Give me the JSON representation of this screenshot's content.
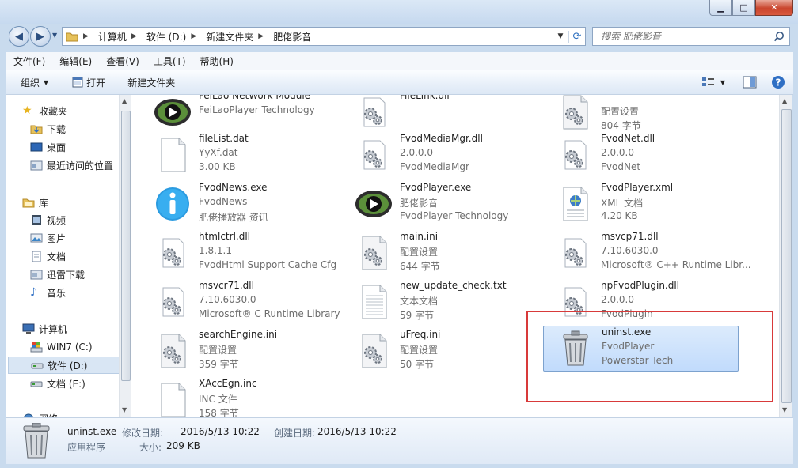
{
  "window": {
    "minimize": "▁",
    "maximize": "□",
    "close": "✕"
  },
  "address": {
    "crumbs": [
      "计算机",
      "软件 (D:)",
      "新建文件夹",
      "肥佬影音"
    ],
    "refresh_icon": "refresh-icon"
  },
  "search": {
    "placeholder": "搜索 肥佬影音"
  },
  "menu": [
    "文件(F)",
    "编辑(E)",
    "查看(V)",
    "工具(T)",
    "帮助(H)"
  ],
  "toolbar": {
    "organize": "组织",
    "open": "打开",
    "new_folder": "新建文件夹"
  },
  "nav": {
    "favorites": "收藏夹",
    "downloads": "下载",
    "desktop": "桌面",
    "recent": "最近访问的位置",
    "libraries": "库",
    "videos": "视频",
    "pictures": "图片",
    "documents": "文档",
    "xunlei": "迅雷下载",
    "music": "音乐",
    "computer": "计算机",
    "drive_c": "WIN7 (C:)",
    "drive_d": "软件 (D:)",
    "drive_e": "文档 (E:)",
    "network": "网络"
  },
  "files": [
    {
      "name": "FeiLao NetWork Module",
      "line2": "FeiLaoPlayer Technology",
      "line3": "",
      "icon": "player-icon"
    },
    {
      "name": "FileLink.dll",
      "line2": "",
      "line3": "",
      "icon": "dll-gear-icon"
    },
    {
      "name": "",
      "line2": "配置设置",
      "line3": "804 字节",
      "icon": "ini-gear-icon"
    },
    {
      "name": "fileList.dat",
      "line2": "YyXf.dat",
      "line3": "3.00 KB",
      "icon": "blank-file-icon"
    },
    {
      "name": "FvodMediaMgr.dll",
      "line2": "2.0.0.0",
      "line3": "FvodMediaMgr",
      "icon": "dll-gear-icon"
    },
    {
      "name": "FvodNet.dll",
      "line2": "2.0.0.0",
      "line3": "FvodNet",
      "icon": "dll-gear-icon"
    },
    {
      "name": "FvodNews.exe",
      "line2": "FvodNews",
      "line3": "肥佬播放器 资讯",
      "icon": "info-icon"
    },
    {
      "name": "FvodPlayer.exe",
      "line2": "肥佬影音",
      "line3": "FvodPlayer Technology",
      "icon": "player-icon"
    },
    {
      "name": "FvodPlayer.xml",
      "line2": "XML 文档",
      "line3": "4.20 KB",
      "icon": "xml-icon"
    },
    {
      "name": "htmlctrl.dll",
      "line2": "1.8.1.1",
      "line3": "FvodHtml Support Cache Cfg",
      "icon": "dll-gear-icon"
    },
    {
      "name": "main.ini",
      "line2": "配置设置",
      "line3": "644 字节",
      "icon": "ini-gear-icon"
    },
    {
      "name": "msvcp71.dll",
      "line2": "7.10.6030.0",
      "line3": "Microsoft® C++ Runtime Libr...",
      "icon": "dll-gear-icon"
    },
    {
      "name": "msvcr71.dll",
      "line2": "7.10.6030.0",
      "line3": "Microsoft® C Runtime Library",
      "icon": "dll-gear-icon"
    },
    {
      "name": "new_update_check.txt",
      "line2": "文本文档",
      "line3": "59 字节",
      "icon": "text-file-icon"
    },
    {
      "name": "npFvodPlugin.dll",
      "line2": "2.0.0.0",
      "line3": "FvodPlugin",
      "icon": "dll-gear-icon"
    },
    {
      "name": "searchEngine.ini",
      "line2": "配置设置",
      "line3": "359 字节",
      "icon": "ini-gear-icon"
    },
    {
      "name": "uFreq.ini",
      "line2": "配置设置",
      "line3": "50 字节",
      "icon": "ini-gear-icon"
    },
    {
      "name": "uninst.exe",
      "line2": "FvodPlayer",
      "line3": "Powerstar Tech",
      "icon": "trash-icon"
    },
    {
      "name": "XAccEgn.inc",
      "line2": "INC 文件",
      "line3": "158 字节",
      "icon": "blank-file-icon"
    }
  ],
  "details": {
    "name": "uninst.exe",
    "type": "应用程序",
    "modified_label": "修改日期:",
    "modified": "2016/5/13 10:22",
    "created_label": "创建日期:",
    "created": "2016/5/13 10:22",
    "size_label": "大小:",
    "size": "209 KB"
  },
  "colors": {
    "highlight_box": "#d83a3a",
    "selection": "#c1dbfc"
  }
}
